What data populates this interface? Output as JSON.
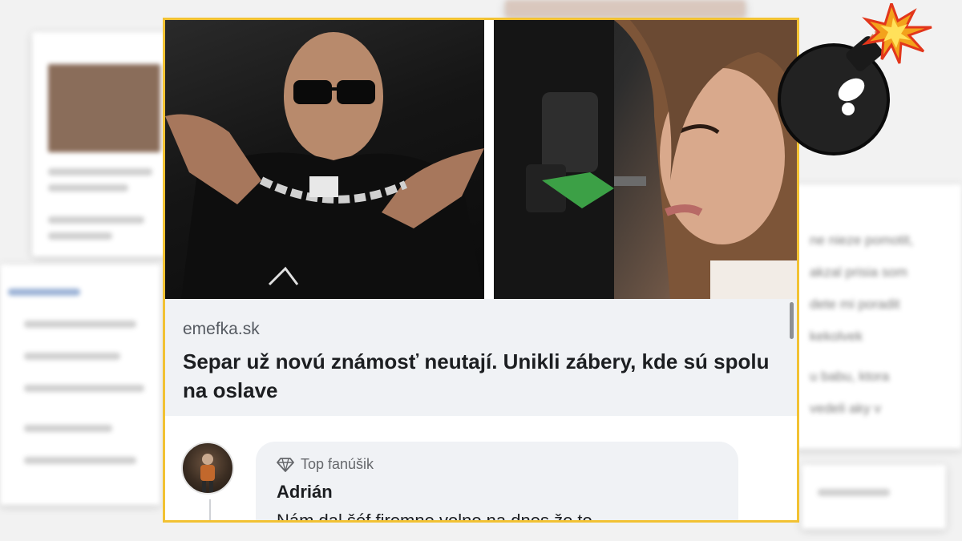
{
  "post": {
    "domain": "emefka.sk",
    "headline": "Separ už novú známosť neutají. Unikli zábery, kde sú spolu na oslave"
  },
  "comment": {
    "badge": "Top fanúšik",
    "author": "Adrián",
    "text": "Nám dal šéf firemne volno na dnes že to"
  },
  "icons": {
    "badge": "diamond-icon",
    "decoration": "bomb-icon"
  },
  "colors": {
    "frame_border": "#f2c233",
    "link_box_bg": "#f0f2f5",
    "bubble_bg": "#f0f2f5"
  }
}
